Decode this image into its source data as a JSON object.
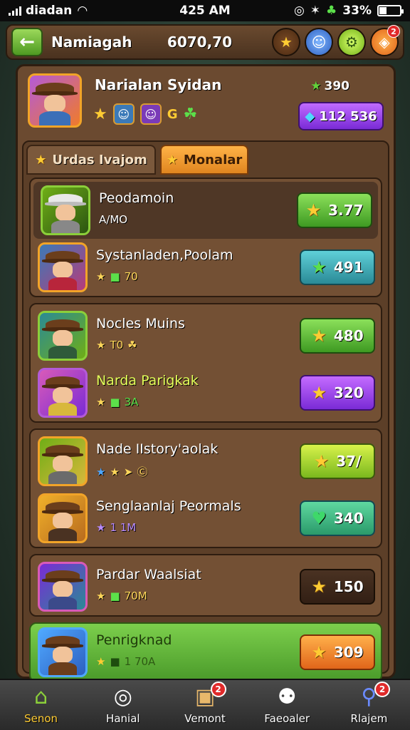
{
  "status_bar": {
    "carrier": "diadan",
    "time": "425 AM",
    "battery": "33%"
  },
  "top_bar": {
    "title": "Namiagah",
    "currency": "6070,70",
    "badge": "2"
  },
  "profile": {
    "name": "Narialan Syidan",
    "score": "390",
    "gems": "112 536",
    "icon_letter": "G"
  },
  "tabs": [
    {
      "label": "Urdas Ivajom"
    },
    {
      "label": "Monalar"
    }
  ],
  "players": [
    {
      "name": "Peodamoin",
      "sub": "A/MO",
      "score": "3.77"
    },
    {
      "name": "Systanladen,Poolam",
      "sub": "70",
      "score": "491"
    },
    {
      "name": "Nocles Muins",
      "sub": "T0",
      "score": "480"
    },
    {
      "name": "Narda Parigkak",
      "sub": "3A",
      "score": "320"
    },
    {
      "name": "Nade IIstory'aolak",
      "sub": "",
      "score": "37/"
    },
    {
      "name": "Senglaanlaj Peormals",
      "sub": "1 1M",
      "score": "340"
    },
    {
      "name": "Pardar Waalsiat",
      "sub": "70M",
      "score": "150"
    },
    {
      "name": "Penrigknad",
      "sub": "1 70A",
      "score": "309"
    }
  ],
  "nav": [
    {
      "label": "Senon"
    },
    {
      "label": "Hanial"
    },
    {
      "label": "Vemont",
      "badge": "2"
    },
    {
      "label": "Faeoaler"
    },
    {
      "label": "Rlajem",
      "badge": "2"
    }
  ]
}
